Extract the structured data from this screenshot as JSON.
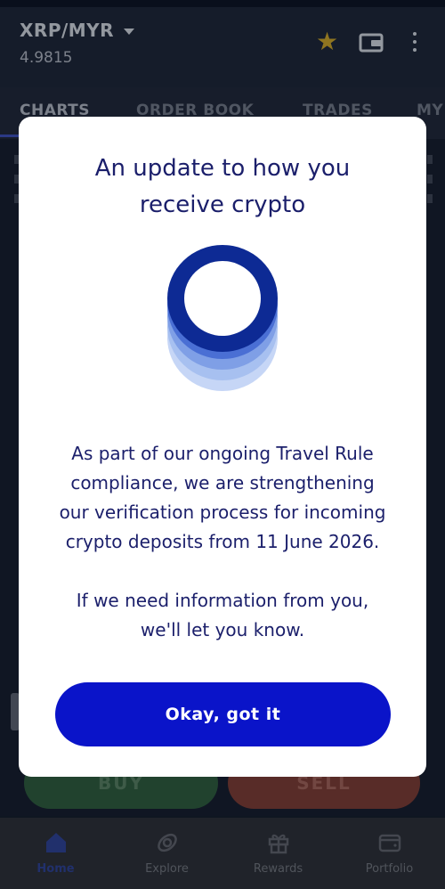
{
  "header": {
    "pair": "XRP/MYR",
    "price": "4.9815"
  },
  "tabs": [
    {
      "label": "CHARTS"
    },
    {
      "label": "ORDER BOOK"
    },
    {
      "label": "TRADES"
    },
    {
      "label": "MY"
    }
  ],
  "actions": {
    "buy_label": "BUY",
    "sell_label": "SELL"
  },
  "bottom_nav": [
    {
      "label": "Home",
      "icon": "home-icon"
    },
    {
      "label": "Explore",
      "icon": "explore-icon"
    },
    {
      "label": "Rewards",
      "icon": "gift-icon"
    },
    {
      "label": "Portfolio",
      "icon": "wallet-icon"
    }
  ],
  "modal": {
    "title_line1": "An update to how you",
    "title_line2": "receive crypto",
    "body_line1": "As part of our ongoing Travel Rule",
    "body_line2": "compliance, we are strengthening",
    "body_line3": "our verification process for incoming",
    "body_line4": "crypto deposits from 11 June 2026.",
    "note_line1": "If we need information from you,",
    "note_line2": "we'll let you know.",
    "button_label": "Okay, got it"
  },
  "colors": {
    "accent": "#0a14c9",
    "title_text": "#1b1f6b",
    "buy": "#2b5a3c",
    "sell": "#7a3a33",
    "star": "#c9a227"
  }
}
